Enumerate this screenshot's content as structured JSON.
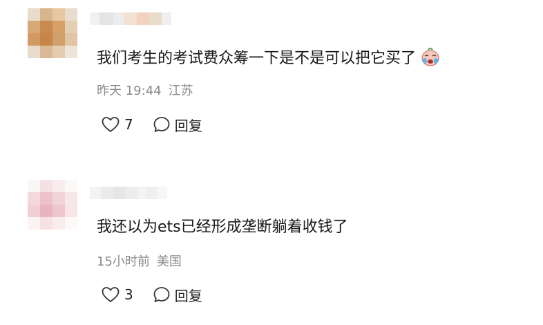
{
  "comments": [
    {
      "avatar_colors": [
        "#e9dccb",
        "#d9b58e",
        "#e7c7a0",
        "#e8dccf",
        "#d8a878",
        "#c98a4f",
        "#d6a066",
        "#e4cfb2",
        "#d29a63",
        "#c58648",
        "#cfa06c",
        "#e0c4a3",
        "#e9dccd",
        "#dcb996",
        "#e5cbb0",
        "#eee5da"
      ],
      "username_colors": [
        "#f1f1f1",
        "#e4e4e4",
        "#ececec",
        "#f2e0d2",
        "#f4d2c0",
        "#eadccd",
        "#f0eeee"
      ],
      "text": "我们考生的考试费众筹一下是不是可以把它买了",
      "emoji": "crying-face-emoji",
      "time": "昨天 19:44",
      "location": "江苏",
      "likes": "7",
      "reply_label": "回复"
    },
    {
      "avatar_colors": [
        "#fbf6f6",
        "#f4e1e3",
        "#f8ecee",
        "#fbf8f8",
        "#f3d8dc",
        "#ecc1c8",
        "#f1d3d8",
        "#f6e7ea",
        "#f1cfd5",
        "#e8b5be",
        "#eec7ce",
        "#f7e5e8",
        "#fbf3f4",
        "#f6e2e5",
        "#f8ecee",
        "#fdf9f9"
      ],
      "username_colors": [
        "#f3f3f3",
        "#ebebeb",
        "#e6e6e6",
        "#ededed",
        "#f4f4f4",
        "#efefef",
        "#f7f7f7"
      ],
      "text": "我还以为ets已经形成垄断躺着收钱了",
      "time": "15小时前",
      "location": "美国",
      "likes": "3",
      "reply_label": "回复"
    }
  ]
}
